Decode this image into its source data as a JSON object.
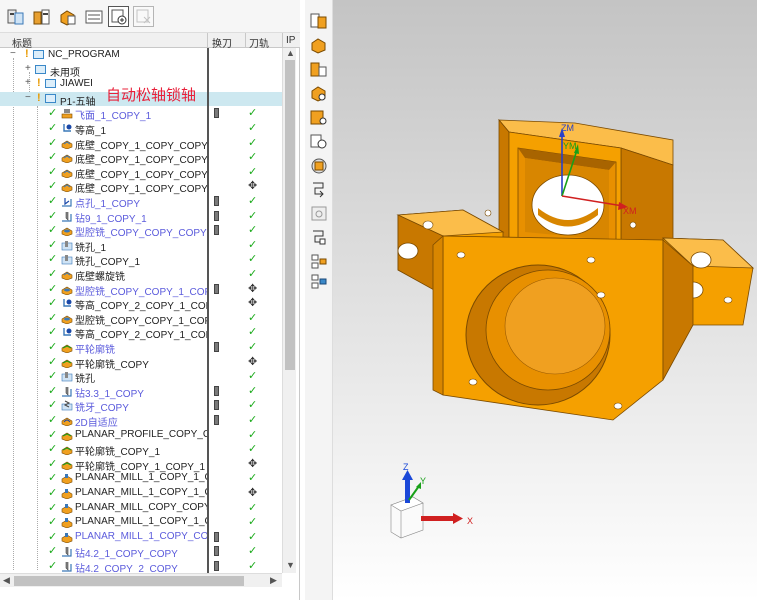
{
  "annotation": "自动松轴锁轴",
  "columns": {
    "name": "标题",
    "tool_change": "换刀",
    "toolpath": "刀轨",
    "ip": "IP"
  },
  "tree": {
    "root": "NC_PROGRAM",
    "unused": "未用项",
    "group1": "JIAWEI",
    "group2": "P1-五轴",
    "operations": [
      {
        "name": "飞面_1_COPY_1",
        "color": "blue",
        "tool": true,
        "path": "ok",
        "icon": "face-mill-icon"
      },
      {
        "name": "等高_1",
        "color": "black",
        "tool": false,
        "path": "ok",
        "icon": "zlevel-icon"
      },
      {
        "name": "底壁_COPY_1_COPY_COPY_1_...",
        "color": "black",
        "tool": false,
        "path": "ok",
        "icon": "floor-wall-icon"
      },
      {
        "name": "底壁_COPY_1_COPY_COPY_1_...",
        "color": "black",
        "tool": false,
        "path": "ok",
        "icon": "floor-wall-icon"
      },
      {
        "name": "底壁_COPY_1_COPY_COPY_1_...",
        "color": "black",
        "tool": false,
        "path": "ok",
        "icon": "floor-wall-icon"
      },
      {
        "name": "底壁_COPY_1_COPY_COPY_1_...",
        "color": "black",
        "tool": false,
        "path": "move",
        "icon": "floor-wall-icon"
      },
      {
        "name": "点孔_1_COPY",
        "color": "blue",
        "tool": true,
        "path": "ok",
        "icon": "spot-drill-icon"
      },
      {
        "name": "钻9_1_COPY_1",
        "color": "blue",
        "tool": true,
        "path": "ok",
        "icon": "drill-icon"
      },
      {
        "name": "型腔铣_COPY_COPY_COPY",
        "color": "blue",
        "tool": true,
        "path": "ok",
        "icon": "cavity-mill-icon"
      },
      {
        "name": "铣孔_1",
        "color": "black",
        "tool": false,
        "path": "ok",
        "icon": "hole-mill-icon"
      },
      {
        "name": "铣孔_COPY_1",
        "color": "black",
        "tool": false,
        "path": "ok",
        "icon": "hole-mill-icon"
      },
      {
        "name": "底壁螺旋铣",
        "color": "black",
        "tool": false,
        "path": "ok",
        "icon": "floor-wall-icon"
      },
      {
        "name": "型腔铣_COPY_COPY_1_COPY_...",
        "color": "blue",
        "tool": true,
        "path": "move",
        "icon": "cavity-mill-icon"
      },
      {
        "name": "等高_COPY_2_COPY_1_COPY_...",
        "color": "black",
        "tool": false,
        "path": "move",
        "icon": "zlevel-icon"
      },
      {
        "name": "型腔铣_COPY_COPY_1_COPY_1",
        "color": "black",
        "tool": false,
        "path": "ok",
        "icon": "cavity-mill-icon"
      },
      {
        "name": "等高_COPY_2_COPY_1_COPY_...",
        "color": "black",
        "tool": false,
        "path": "ok",
        "icon": "zlevel-icon"
      },
      {
        "name": "平轮廓铣",
        "color": "blue",
        "tool": true,
        "path": "ok",
        "icon": "planar-profile-icon"
      },
      {
        "name": "平轮廓铣_COPY",
        "color": "black",
        "tool": false,
        "path": "move",
        "icon": "planar-profile-icon"
      },
      {
        "name": "铣孔",
        "color": "black",
        "tool": false,
        "path": "ok",
        "icon": "hole-mill-icon"
      },
      {
        "name": "钻3.3_1_COPY",
        "color": "blue",
        "tool": true,
        "path": "ok",
        "icon": "drill-icon"
      },
      {
        "name": "铣牙_COPY",
        "color": "blue",
        "tool": true,
        "path": "ok",
        "icon": "thread-mill-icon"
      },
      {
        "name": "2D自适应",
        "color": "blue",
        "tool": true,
        "path": "ok",
        "icon": "adaptive-icon"
      },
      {
        "name": "PLANAR_PROFILE_COPY_COP...",
        "color": "black",
        "tool": false,
        "path": "ok",
        "icon": "planar-profile-icon"
      },
      {
        "name": "平轮廓铣_COPY_1",
        "color": "black",
        "tool": false,
        "path": "ok",
        "icon": "planar-profile-icon"
      },
      {
        "name": "平轮廓铣_COPY_1_COPY_1",
        "color": "black",
        "tool": false,
        "path": "move",
        "icon": "planar-profile-icon"
      },
      {
        "name": "PLANAR_MILL_1_COPY_1_CO...",
        "color": "black",
        "tool": false,
        "path": "ok",
        "icon": "planar-mill-icon"
      },
      {
        "name": "PLANAR_MILL_1_COPY_1_CO...",
        "color": "black",
        "tool": false,
        "path": "move",
        "icon": "planar-mill-icon"
      },
      {
        "name": "PLANAR_MILL_COPY_COPY_1",
        "color": "black",
        "tool": false,
        "path": "ok",
        "icon": "planar-mill-icon"
      },
      {
        "name": "PLANAR_MILL_1_COPY_1_CO...",
        "color": "black",
        "tool": false,
        "path": "ok",
        "icon": "planar-mill-icon"
      },
      {
        "name": "PLANAR_MILL_1_COPY_COPY...",
        "color": "blue",
        "tool": true,
        "path": "ok",
        "icon": "planar-mill-icon"
      },
      {
        "name": "钻4.2_1_COPY_COPY",
        "color": "blue",
        "tool": true,
        "path": "ok",
        "icon": "drill-icon"
      },
      {
        "name": "钻4.2_COPY_2_COPY",
        "color": "blue",
        "tool": true,
        "path": "ok",
        "icon": "drill-icon"
      }
    ]
  },
  "glyphs": {
    "ok": "✓",
    "move": "✥",
    "check": "✓",
    "warn": "!",
    "collapse": "−",
    "expand": "+"
  },
  "toolbar_icons": [
    "program-order-view-icon",
    "machine-tool-view-icon",
    "geometry-view-icon",
    "method-view-icon",
    "create-program-icon",
    "delete-icon"
  ],
  "viewport": {
    "part_color": "#f5a000",
    "wcs_labels": {
      "zm": "ZM",
      "ym": "YM",
      "xm": "XM"
    },
    "triad_labels": {
      "z": "Z",
      "y": "Y",
      "x": "X"
    }
  },
  "colors": {
    "blue_text": "#5b5bdc",
    "check_green": "#1aaa1a",
    "annotation_red": "#e8203a",
    "selection": "#cde8f0"
  }
}
